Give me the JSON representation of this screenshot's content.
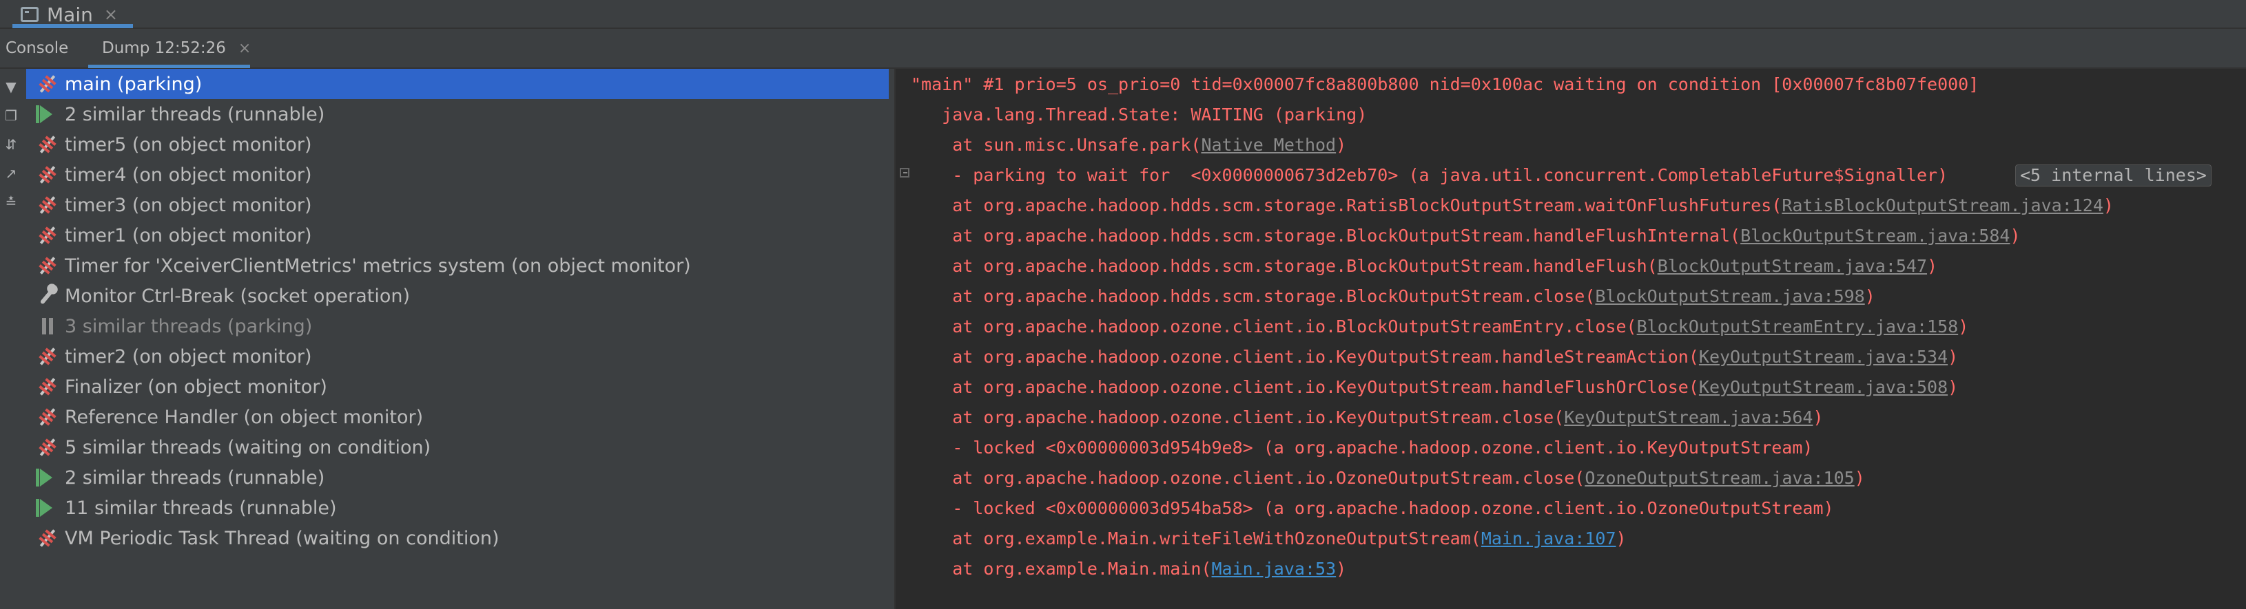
{
  "run_tabs": {
    "main_label": "Main",
    "close": "×"
  },
  "sub_tabs": {
    "console_label": "Console",
    "dump_label": "Dump 12:52:26",
    "close": "×"
  },
  "toolbar": {
    "buttons": [
      {
        "name": "filter-icon",
        "glyph": "▼"
      },
      {
        "name": "copy-icon",
        "glyph": "❐"
      },
      {
        "name": "sort-icon",
        "glyph": "⇵"
      },
      {
        "name": "export-icon",
        "glyph": "↗"
      },
      {
        "name": "merge-icon",
        "glyph": "≛"
      }
    ]
  },
  "threads": [
    {
      "label": "main (parking)",
      "icon": "parking",
      "selected": true,
      "dim": false
    },
    {
      "label": "2 similar threads (runnable)",
      "icon": "runnable",
      "selected": false,
      "dim": false
    },
    {
      "label": "timer5 (on object monitor)",
      "icon": "parking",
      "selected": false,
      "dim": false
    },
    {
      "label": "timer4 (on object monitor)",
      "icon": "parking",
      "selected": false,
      "dim": false
    },
    {
      "label": "timer3 (on object monitor)",
      "icon": "parking",
      "selected": false,
      "dim": false
    },
    {
      "label": "timer1 (on object monitor)",
      "icon": "parking",
      "selected": false,
      "dim": false
    },
    {
      "label": "Timer for 'XceiverClientMetrics' metrics system (on object monitor)",
      "icon": "parking",
      "selected": false,
      "dim": false
    },
    {
      "label": "Monitor Ctrl-Break (socket operation)",
      "icon": "wrench",
      "selected": false,
      "dim": false
    },
    {
      "label": "3 similar threads (parking)",
      "icon": "pause",
      "selected": false,
      "dim": true
    },
    {
      "label": "timer2 (on object monitor)",
      "icon": "parking",
      "selected": false,
      "dim": false
    },
    {
      "label": "Finalizer (on object monitor)",
      "icon": "parking",
      "selected": false,
      "dim": false
    },
    {
      "label": "Reference Handler (on object monitor)",
      "icon": "parking",
      "selected": false,
      "dim": false
    },
    {
      "label": "5 similar threads (waiting on condition)",
      "icon": "parking",
      "selected": false,
      "dim": false
    },
    {
      "label": "2 similar threads (runnable)",
      "icon": "runnable",
      "selected": false,
      "dim": false
    },
    {
      "label": "11 similar threads (runnable)",
      "icon": "runnable",
      "selected": false,
      "dim": false
    },
    {
      "label": "VM Periodic Task Thread (waiting on condition)",
      "icon": "parking",
      "selected": false,
      "dim": false
    }
  ],
  "dump": {
    "lines": [
      {
        "text": "\"main\" #1 prio=5 os_prio=0 tid=0x00007fc8a800b800 nid=0x100ac waiting on condition [0x00007fc8b07fe000]",
        "link": "",
        "link_style": "",
        "suffix": "",
        "indent": 0
      },
      {
        "text": "   java.lang.Thread.State: WAITING (parking)",
        "link": "",
        "link_style": "",
        "suffix": "",
        "indent": 0
      },
      {
        "text": "    at sun.misc.Unsafe.park(",
        "link": "Native Method",
        "link_style": "flink",
        "suffix": ")",
        "indent": 0
      },
      {
        "text": "    - parking to wait for  <0x0000000673d2eb70> (a java.util.concurrent.CompletableFuture$Signaller)",
        "link": "",
        "link_style": "",
        "suffix": "",
        "indent": 0,
        "badge": "<5 internal lines>"
      },
      {
        "text": "    at org.apache.hadoop.hdds.scm.storage.RatisBlockOutputStream.waitOnFlushFutures(",
        "link": "RatisBlockOutputStream.java:124",
        "link_style": "flink",
        "suffix": ")",
        "indent": 0
      },
      {
        "text": "    at org.apache.hadoop.hdds.scm.storage.BlockOutputStream.handleFlushInternal(",
        "link": "BlockOutputStream.java:584",
        "link_style": "flink",
        "suffix": ")",
        "indent": 0
      },
      {
        "text": "    at org.apache.hadoop.hdds.scm.storage.BlockOutputStream.handleFlush(",
        "link": "BlockOutputStream.java:547",
        "link_style": "flink",
        "suffix": ")",
        "indent": 0
      },
      {
        "text": "    at org.apache.hadoop.hdds.scm.storage.BlockOutputStream.close(",
        "link": "BlockOutputStream.java:598",
        "link_style": "flink",
        "suffix": ")",
        "indent": 0
      },
      {
        "text": "    at org.apache.hadoop.ozone.client.io.BlockOutputStreamEntry.close(",
        "link": "BlockOutputStreamEntry.java:158",
        "link_style": "flink",
        "suffix": ")",
        "indent": 0
      },
      {
        "text": "    at org.apache.hadoop.ozone.client.io.KeyOutputStream.handleStreamAction(",
        "link": "KeyOutputStream.java:534",
        "link_style": "flink",
        "suffix": ")",
        "indent": 0
      },
      {
        "text": "    at org.apache.hadoop.ozone.client.io.KeyOutputStream.handleFlushOrClose(",
        "link": "KeyOutputStream.java:508",
        "link_style": "flink",
        "suffix": ")",
        "indent": 0
      },
      {
        "text": "    at org.apache.hadoop.ozone.client.io.KeyOutputStream.close(",
        "link": "KeyOutputStream.java:564",
        "link_style": "flink",
        "suffix": ")",
        "indent": 0
      },
      {
        "text": "    - locked <0x00000003d954b9e8> (a org.apache.hadoop.ozone.client.io.KeyOutputStream)",
        "link": "",
        "link_style": "",
        "suffix": "",
        "indent": 0
      },
      {
        "text": "    at org.apache.hadoop.ozone.client.io.OzoneOutputStream.close(",
        "link": "OzoneOutputStream.java:105",
        "link_style": "flink",
        "suffix": ")",
        "indent": 0
      },
      {
        "text": "    - locked <0x00000003d954ba58> (a org.apache.hadoop.ozone.client.io.OzoneOutputStream)",
        "link": "",
        "link_style": "",
        "suffix": "",
        "indent": 0
      },
      {
        "text": "    at org.example.Main.writeFileWithOzoneOutputStream(",
        "link": "Main.java:107",
        "link_style": "blink",
        "suffix": ")",
        "indent": 0
      },
      {
        "text": "    at org.example.Main.main(",
        "link": "Main.java:53",
        "link_style": "blink",
        "suffix": ")",
        "indent": 0
      }
    ]
  }
}
